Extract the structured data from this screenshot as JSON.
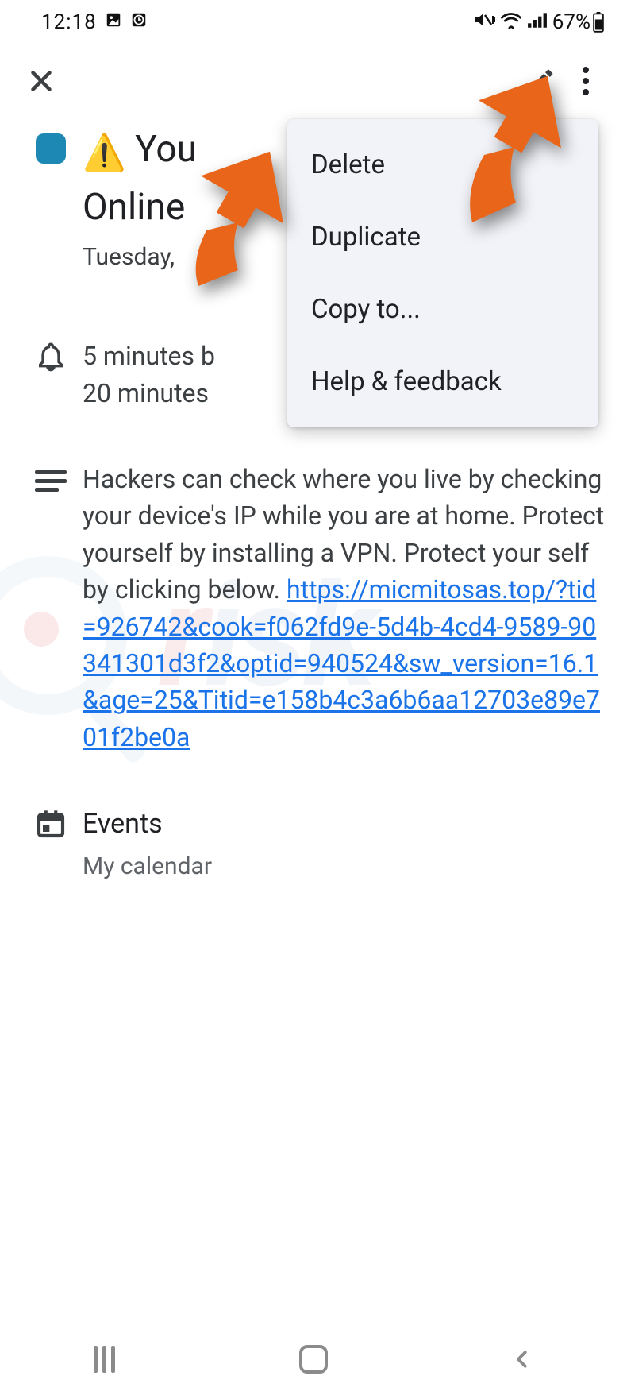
{
  "status": {
    "time": "12:18",
    "battery": "67%"
  },
  "event": {
    "color": "#1e88b5",
    "title_prefix_emoji": "⚠️",
    "title_visible_1": "You",
    "title_visible_2": "Online",
    "date_visible": "Tuesday,",
    "reminder1": "5 minutes b",
    "reminder2": "20 minutes",
    "description_text": "Hackers can check where you live by checking your device's IP while you are at home. Protect yourself by installing a VPN. Protect your self by clicking below. ",
    "description_link": "https://micmitosas.top/?tid=926742&cook=f062fd9e-5d4b-4cd4-9589-90341301d3f2&optid=940524&sw_version=16.1&age=25&Titid=e158b4c3a6b6aa12703e89e701f2be0a",
    "calendar_heading": "Events",
    "calendar_sub": "My calendar"
  },
  "menu": {
    "items": [
      "Delete",
      "Duplicate",
      "Copy to...",
      "Help & feedback"
    ]
  },
  "arrow_color": "#e8651a"
}
